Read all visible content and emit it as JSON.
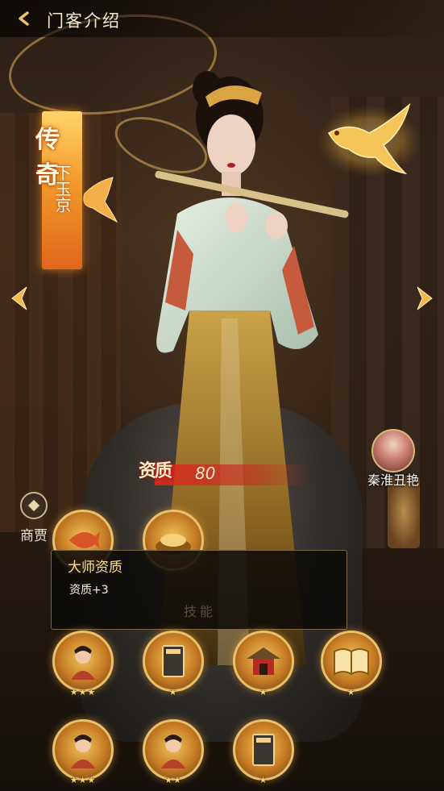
{
  "header": {
    "title": "门客介绍"
  },
  "hero": {
    "rarity": "传奇",
    "name": "下玉京"
  },
  "quality": {
    "label": "资质",
    "value": "80"
  },
  "faction": {
    "label": "商贾",
    "icon": "coin-icon"
  },
  "partner": {
    "name": "秦淮丑艳"
  },
  "tooltip": {
    "title": "大师资质",
    "description": "资质+3",
    "faded_label": "技能"
  },
  "skills": [
    {
      "icon": "koi-fish-icon",
      "stars": ""
    },
    {
      "icon": "gold-pile-icon",
      "stars": ""
    },
    {
      "icon": "warrior-portrait-icon",
      "stars": "★★★"
    },
    {
      "icon": "scroll-book-icon",
      "stars": "★"
    },
    {
      "icon": "pavilion-icon",
      "stars": "★"
    },
    {
      "icon": "open-book-icon",
      "stars": "★"
    },
    {
      "icon": "warrior-portrait-icon",
      "stars": "★★★"
    },
    {
      "icon": "warrior-portrait-icon",
      "stars": "★★"
    },
    {
      "icon": "scroll-book-icon",
      "stars": "★"
    }
  ],
  "colors": {
    "rarity_gradient_top": "#ffd36a",
    "rarity_gradient_bottom": "#e0661c",
    "quality_bar": "#dc281e",
    "gold_accent": "#e9c16b"
  }
}
